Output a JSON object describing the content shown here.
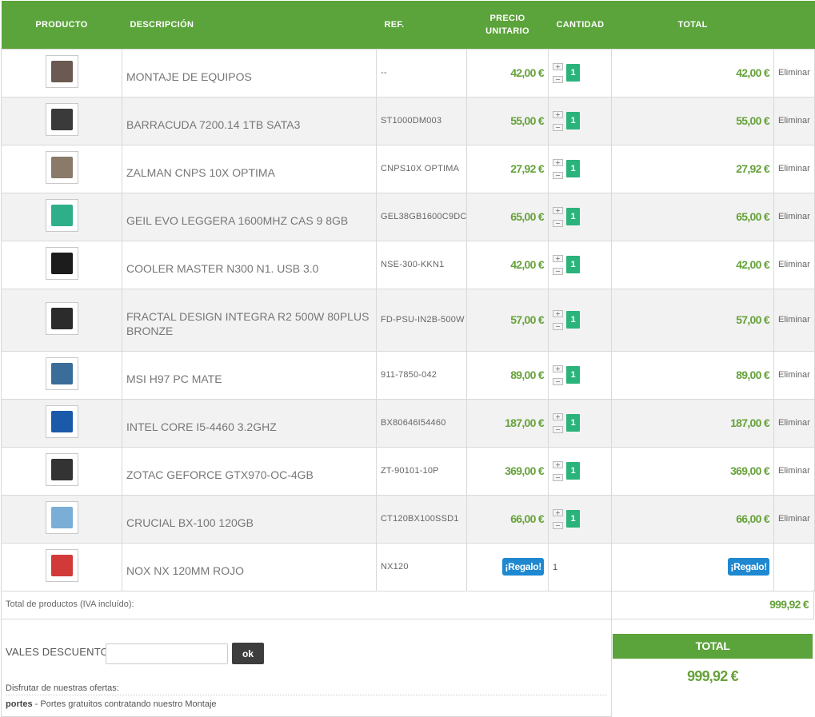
{
  "headers": {
    "producto": "PRODUCTO",
    "descripcion": "DESCRIPCIÓN",
    "ref": "REF.",
    "precio_line1": "PRECIO",
    "precio_line2": "UNITARIO",
    "cantidad": "CANTIDAD",
    "total": "TOTAL"
  },
  "items": [
    {
      "desc": "MONTAJE DE EQUIPOS",
      "ref": "--",
      "price": "42,00 €",
      "qty": "1",
      "total": "42,00 €",
      "action": "Eliminar",
      "icon": "assembly-photo-icon",
      "color": "#6b5a52"
    },
    {
      "desc": "BARRACUDA 7200.14 1TB SATA3",
      "ref": "ST1000DM003",
      "price": "55,00 €",
      "qty": "1",
      "total": "55,00 €",
      "action": "Eliminar",
      "icon": "hard-drive-icon",
      "color": "#3a3a3a"
    },
    {
      "desc": "ZALMAN CNPS 10X OPTIMA",
      "ref": "CNPS10X OPTIMA",
      "price": "27,92 €",
      "qty": "1",
      "total": "27,92 €",
      "action": "Eliminar",
      "icon": "cpu-cooler-icon",
      "color": "#8a7a6a"
    },
    {
      "desc": "GEIL EVO LEGGERA 1600MHZ CAS 9 8GB",
      "ref": "GEL38GB1600C9DC",
      "price": "65,00 €",
      "qty": "1",
      "total": "65,00 €",
      "action": "Eliminar",
      "icon": "ram-icon",
      "color": "#2fae8a"
    },
    {
      "desc": "COOLER MASTER N300 N1. USB 3.0",
      "ref": "NSE-300-KKN1",
      "price": "42,00 €",
      "qty": "1",
      "total": "42,00 €",
      "action": "Eliminar",
      "icon": "pc-case-icon",
      "color": "#1c1c1c"
    },
    {
      "desc": "FRACTAL DESIGN INTEGRA R2 500W 80PLUS BRONZE",
      "ref": "FD-PSU-IN2B-500W",
      "price": "57,00 €",
      "qty": "1",
      "total": "57,00 €",
      "action": "Eliminar",
      "icon": "power-supply-icon",
      "color": "#2b2b2b"
    },
    {
      "desc": "MSI H97 PC MATE",
      "ref": "911-7850-042",
      "price": "89,00 €",
      "qty": "1",
      "total": "89,00 €",
      "action": "Eliminar",
      "icon": "motherboard-icon",
      "color": "#3a6d9a"
    },
    {
      "desc": "INTEL CORE I5-4460 3.2GHZ",
      "ref": "BX80646I54460",
      "price": "187,00 €",
      "qty": "1",
      "total": "187,00 €",
      "action": "Eliminar",
      "icon": "cpu-box-icon",
      "color": "#1a5aa8"
    },
    {
      "desc": "ZOTAC GEFORCE GTX970-OC-4GB",
      "ref": "ZT-90101-10P",
      "price": "369,00 €",
      "qty": "1",
      "total": "369,00 €",
      "action": "Eliminar",
      "icon": "graphics-card-icon",
      "color": "#333333"
    },
    {
      "desc": "CRUCIAL BX-100 120GB",
      "ref": "CT120BX100SSD1",
      "price": "66,00 €",
      "qty": "1",
      "total": "66,00 €",
      "action": "Eliminar",
      "icon": "ssd-icon",
      "color": "#7aaed6"
    },
    {
      "desc": "NOX NX 120MM ROJO",
      "ref": "NX120",
      "price": "¡Regalo!",
      "qty": "1",
      "total": "¡Regalo!",
      "action": "",
      "icon": "case-fan-icon",
      "color": "#d23a3a",
      "gift": true
    }
  ],
  "summary": {
    "subtotal_label": "Total de productos (IVA incluído):",
    "subtotal_value": "999,92 €",
    "vales_label": "VALES DESCUENTO",
    "vales_input_value": "",
    "ok_label": "ok",
    "ofertas_label": "Disfrutar de nuestras ofertas:",
    "offer_code": "portes",
    "offer_text": " - Portes gratuitos contratando nuestro Montaje",
    "total_label": "TOTAL",
    "total_value": "999,92 €"
  },
  "colors": {
    "accent_green": "#5ba33b",
    "price_green": "#66a23a",
    "qty_green": "#2ab37a",
    "gift_blue": "#1e88d0"
  }
}
